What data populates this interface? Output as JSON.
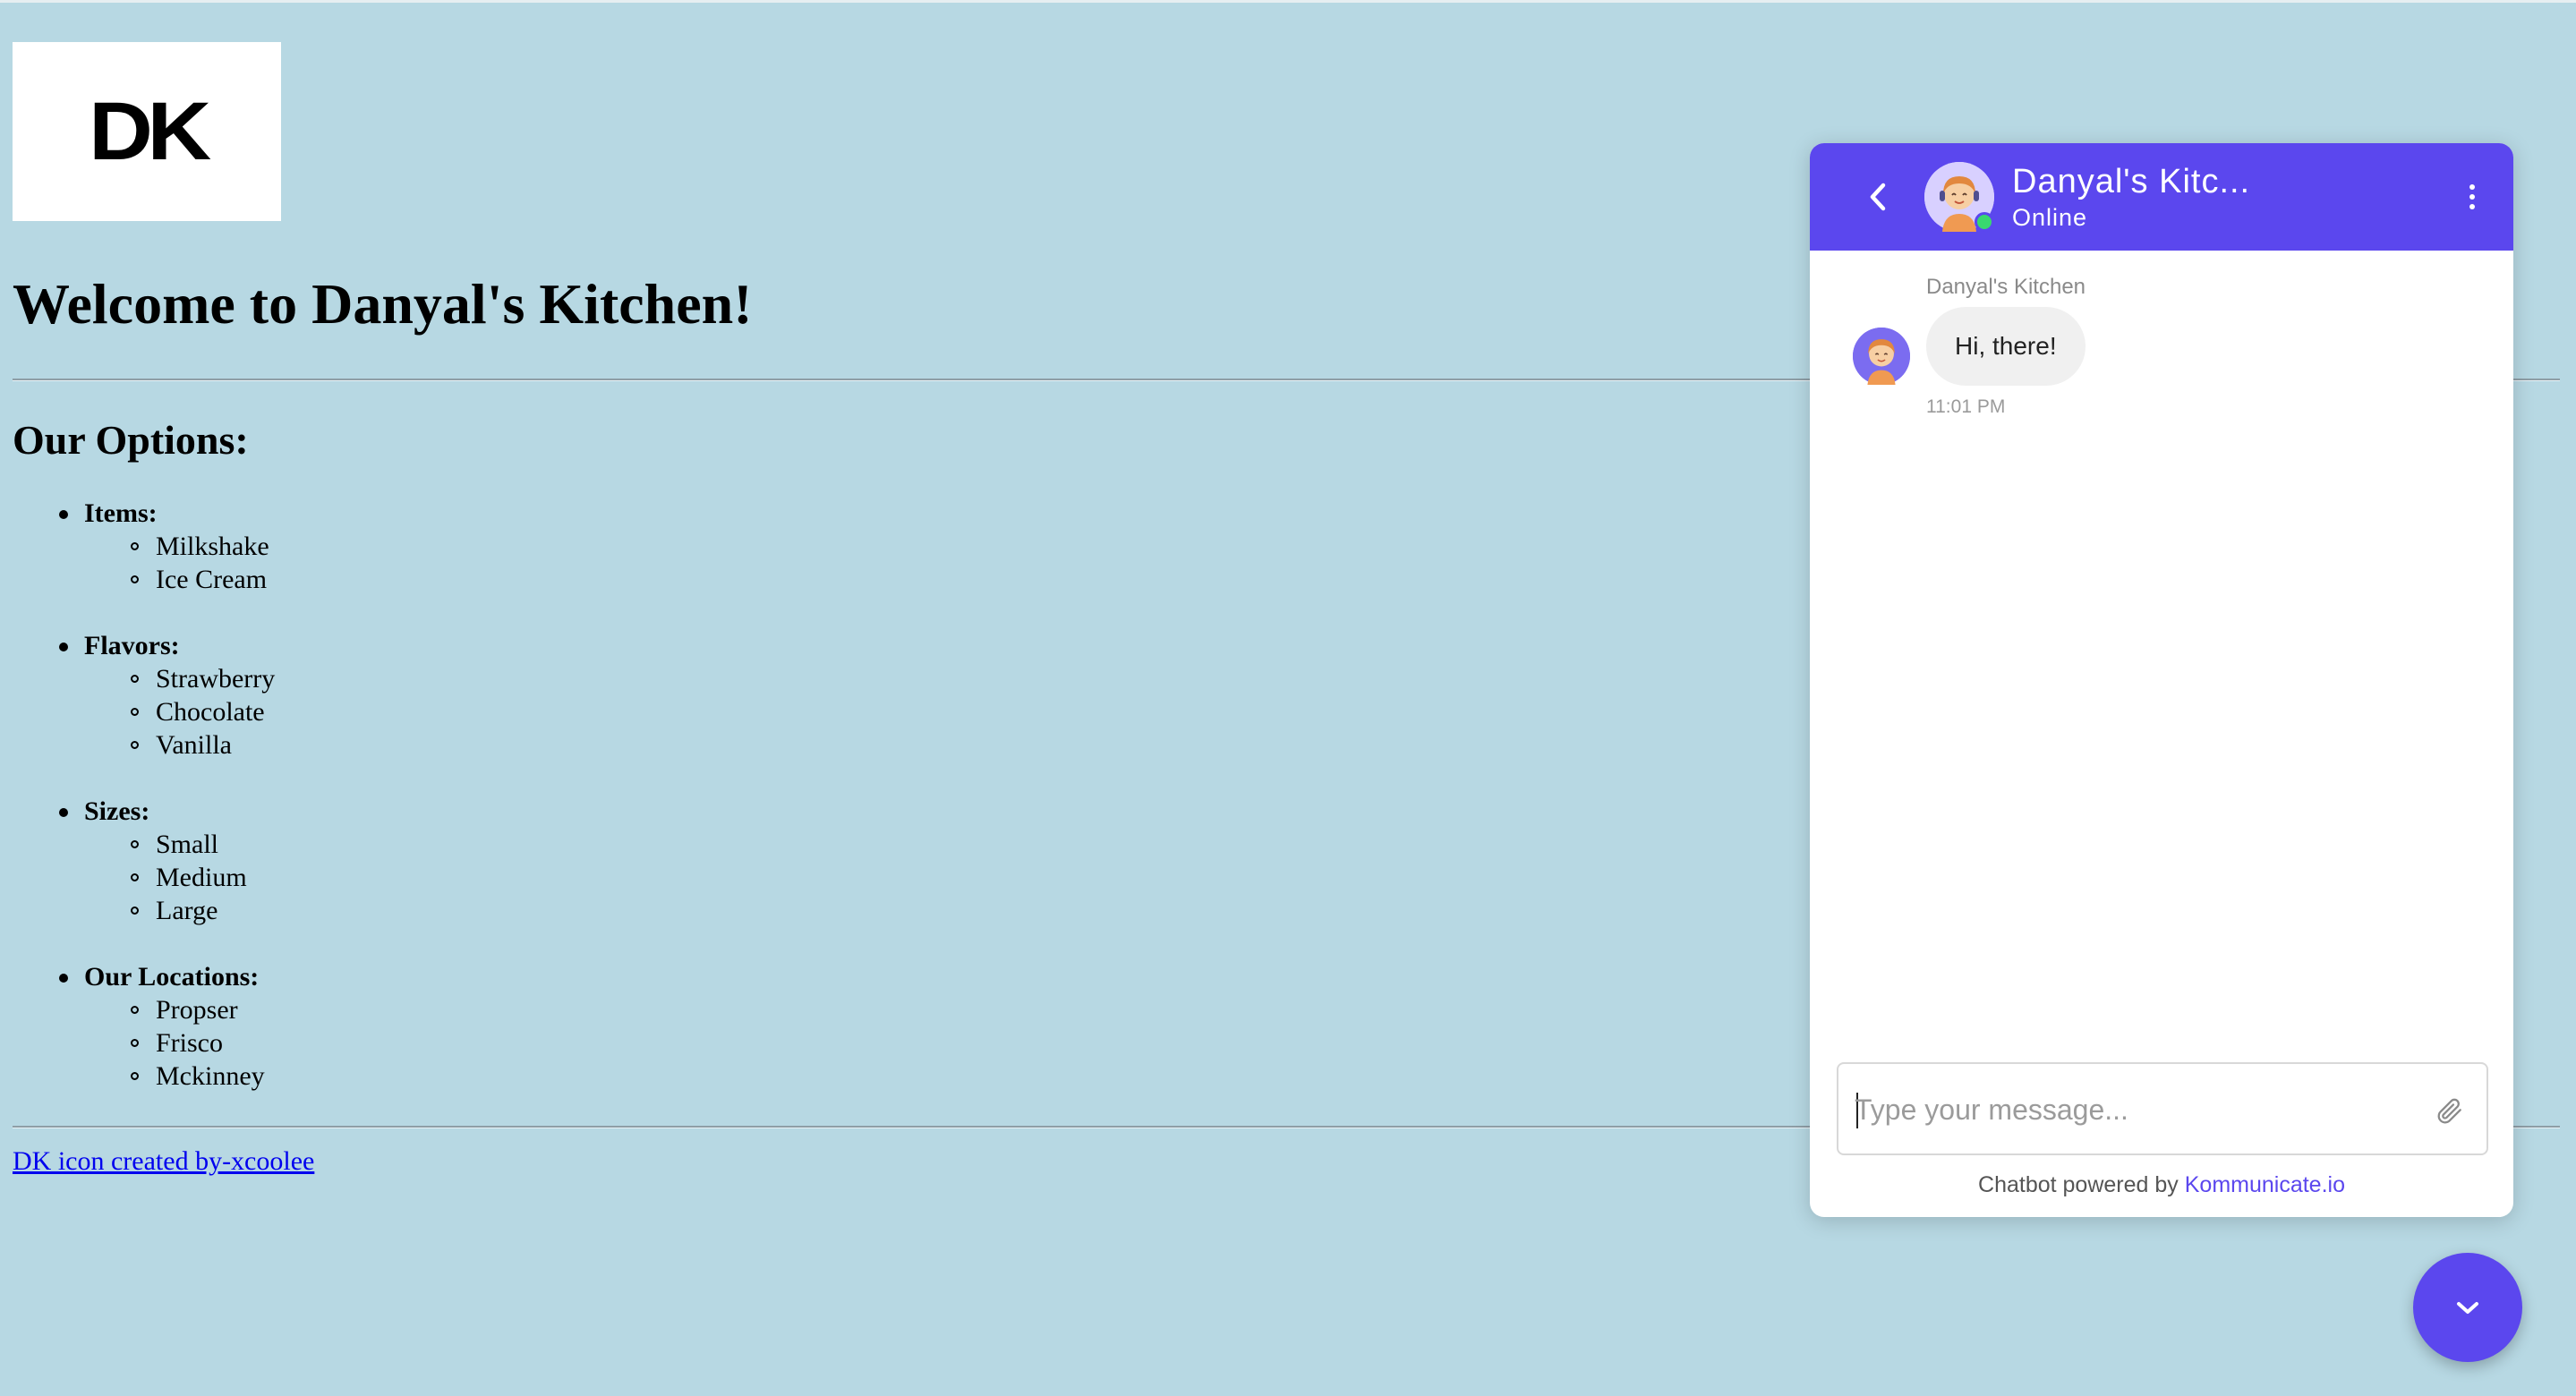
{
  "logo": {
    "text": "DK"
  },
  "page": {
    "title": "Welcome to Danyal's Kitchen!",
    "options_heading": "Our Options:",
    "categories": [
      {
        "label": "Items:",
        "items": [
          "Milkshake",
          "Ice Cream"
        ]
      },
      {
        "label": "Flavors:",
        "items": [
          "Strawberry",
          "Chocolate",
          "Vanilla"
        ]
      },
      {
        "label": "Sizes:",
        "items": [
          "Small",
          "Medium",
          "Large"
        ]
      },
      {
        "label": "Our Locations:",
        "items": [
          "Propser",
          "Frisco",
          "Mckinney"
        ]
      }
    ],
    "credit_link": "DK icon created by-xcoolee"
  },
  "chat": {
    "header": {
      "name": "Danyal's Kitc...",
      "status": "Online"
    },
    "messages": [
      {
        "sender": "Danyal's Kitchen",
        "text": "Hi, there!",
        "time": "11:01 PM"
      }
    ],
    "input": {
      "placeholder": "Type your message...",
      "value": ""
    },
    "powered_prefix": "Chatbot powered by",
    "powered_link": "Kommunicate.io"
  },
  "colors": {
    "page_background": "#b7d8e3",
    "chat_accent": "#5b47ee",
    "online_indicator": "#39d86f",
    "link": "#0000ee"
  },
  "icons": {
    "back": "chevron-left-icon",
    "menu": "more-vertical-icon",
    "attach": "paperclip-icon",
    "fab": "chevron-down-icon"
  }
}
